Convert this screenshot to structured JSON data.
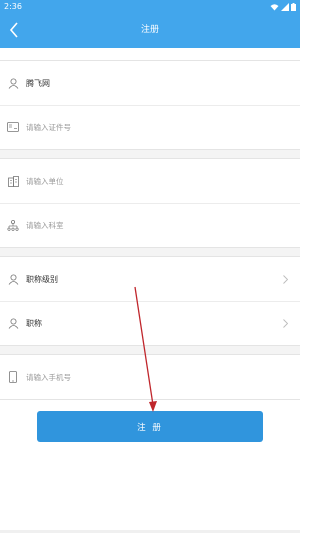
{
  "status_bar": {
    "time": "2:36"
  },
  "header": {
    "title": "注册"
  },
  "form": {
    "name_value": "腾飞网",
    "id_number_placeholder": "请输入证件号",
    "unit_placeholder": "请输入单位",
    "department_placeholder": "请输入科室",
    "title_level_label": "职称级别",
    "title_label": "职称",
    "phone_placeholder": "请输入手机号"
  },
  "register_button": {
    "label": "注 册"
  },
  "colors": {
    "primary": "#42a6ec",
    "button": "#3095dd",
    "annotation_arrow": "#c0262c"
  },
  "icons": {
    "status": [
      "wifi-icon",
      "signal-icon",
      "battery-icon"
    ],
    "fields": [
      "user-icon",
      "id-card-icon",
      "building-icon",
      "org-chart-icon",
      "user-icon",
      "user-icon",
      "phone-icon"
    ]
  }
}
